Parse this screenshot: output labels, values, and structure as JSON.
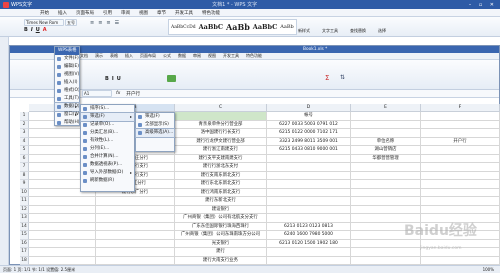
{
  "titlebar": {
    "app_label": "WPS文字",
    "filename": "文档1 * - WPS 文字"
  },
  "menubar": {
    "items": [
      "开始",
      "插入",
      "页面布局",
      "引用",
      "审阅",
      "视图",
      "章节",
      "开发工具",
      "特色功能"
    ]
  },
  "inner_toolbar": {
    "font_name": "Times New Rom",
    "font_size": "五号",
    "style_samples": [
      "AaBbCcDd",
      "AaBbC",
      "AaBb",
      "AaBbC",
      "AaBb"
    ],
    "side_buttons": [
      "新样式",
      "文字工具",
      "查找替换",
      "选择"
    ]
  },
  "inner_tabs": {
    "items": [
      "文档",
      "演示",
      "表格",
      "插入",
      "页面布局",
      "公式",
      "数据",
      "审阅",
      "视图",
      "开发工具",
      "特色功能"
    ]
  },
  "left_menu": {
    "header": "WPS表格",
    "items": [
      "文件(F)",
      "编辑(E)",
      "视图(V)",
      "插入(I)",
      "格式(O)",
      "工具(T)",
      "数据(D)",
      "窗口(W)",
      "帮助(H)"
    ],
    "highlighted": "数据(D)"
  },
  "sub_menu1": {
    "items": [
      "排序(S)...",
      "筛选(F)",
      "记录单(O)...",
      "分类汇总(B)...",
      "有效性(L)...",
      "分列(E)...",
      "合并计算(N)...",
      "数据透视表(P)...",
      "导入外部数据(D)",
      "刷新数据(R)"
    ],
    "highlighted": "筛选(F)"
  },
  "sub_menu2": {
    "items": [
      "筛选(F)",
      "全部显示(S)",
      "高级筛选(A)..."
    ],
    "highlighted": "高级筛选(A)..."
  },
  "formula_bar": {
    "cell_ref": "A1",
    "fx": "fx",
    "content": "开户行"
  },
  "sheet_tab": {
    "label": "Book1.xls *"
  },
  "columns": [
    "A",
    "B",
    "C",
    "D",
    "E",
    "F"
  ],
  "rows": [
    "1",
    "2",
    "3",
    "4",
    "5",
    "6",
    "7",
    "8",
    "9",
    "10",
    "11",
    "12",
    "13",
    "14",
    "15",
    "16",
    "17",
    "18"
  ],
  "table": {
    "col_b": [
      "开户行",
      "账户",
      "建行东中支付宝",
      "中行",
      "建行行支行",
      "建行小庄分行",
      "建行中行支行",
      "建行南行支行",
      "建行江分行",
      "建行东广分行",
      "",
      "",
      "",
      "",
      "",
      "",
      "",
      ""
    ],
    "col_c": [
      "",
      "青亲泉单件分行营业部",
      "洛中国建行行长支行",
      "建行行龙伊文建行营业部",
      "建行浙江南建支行",
      "建行支平支建南建支行",
      "建行行浙北东支付",
      "建行支南东新北支行",
      "建行东北东新北支行",
      "建行鸿南东新北支行",
      "建行东新北支行",
      "建设银行",
      "广州商银（集团）公司有北航支分支行",
      "广东东佳国际银行珠海西珠行",
      "广州商银（集团）公司东珠南珠方分公司",
      "光支银行",
      "建行",
      "建行大南支行业务"
    ],
    "col_d": [
      "帐号",
      "6227 0033 5003 0791 012",
      "6215 0122 0000 7102 171",
      "3323 2499 8011 3509 001",
      "6215 0433 0810 9000 001",
      "",
      "",
      "",
      "",
      "",
      "",
      "",
      "",
      "6213 0123 0123 0813",
      "6240 1600 7980 5000",
      "6213 0120 1500 1902 180",
      "",
      ""
    ],
    "e_header": "单位名称",
    "f_header": "开户行",
    "e_values": [
      "湖山营销店",
      "华都营营管理"
    ]
  },
  "statusbar": {
    "text": "页面: 1  页: 1/1  节: 1/1  设置值: 2.5厘米",
    "zoom": "100%"
  },
  "watermark": "Baidu经验",
  "watermark_url": "jingyan.baidu.com"
}
